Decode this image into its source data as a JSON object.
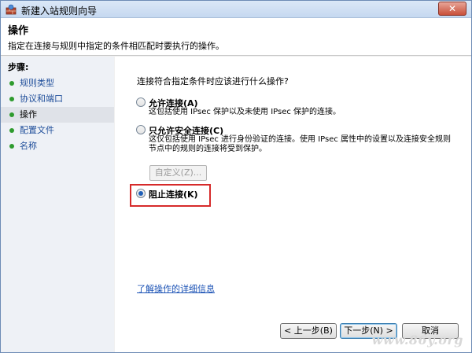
{
  "window": {
    "title": "新建入站规则向导",
    "close_label": "✕"
  },
  "header": {
    "title": "操作",
    "description": "指定在连接与规则中指定的条件相匹配时要执行的操作。"
  },
  "steps": {
    "title": "步骤:",
    "items": [
      {
        "label": "规则类型",
        "active": false
      },
      {
        "label": "协议和端口",
        "active": false
      },
      {
        "label": "操作",
        "active": true
      },
      {
        "label": "配置文件",
        "active": false
      },
      {
        "label": "名称",
        "active": false
      }
    ]
  },
  "main": {
    "question": "连接符合指定条件时应该进行什么操作?",
    "options": [
      {
        "label": "允许连接(A)",
        "description": "这包括使用 IPsec 保护以及未使用 IPsec 保护的连接。",
        "checked": false
      },
      {
        "label": "只允许安全连接(C)",
        "description": "这仅包括使用 IPsec 进行身份验证的连接。使用 IPsec 属性中的设置以及连接安全规则节点中的规则的连接将受到保护。",
        "checked": false
      },
      {
        "label": "阻止连接(K)",
        "description": "",
        "checked": true
      }
    ],
    "customize_label": "自定义(Z)...",
    "learn_more": "了解操作的详细信息"
  },
  "buttons": {
    "back": "< 上一步(B)",
    "next": "下一步(N) >",
    "cancel": "取消"
  },
  "watermark": "www.86y.org",
  "colors": {
    "highlight": "#d62a2a",
    "link": "#1b52b5",
    "step_dot": "#2e9b2e"
  }
}
